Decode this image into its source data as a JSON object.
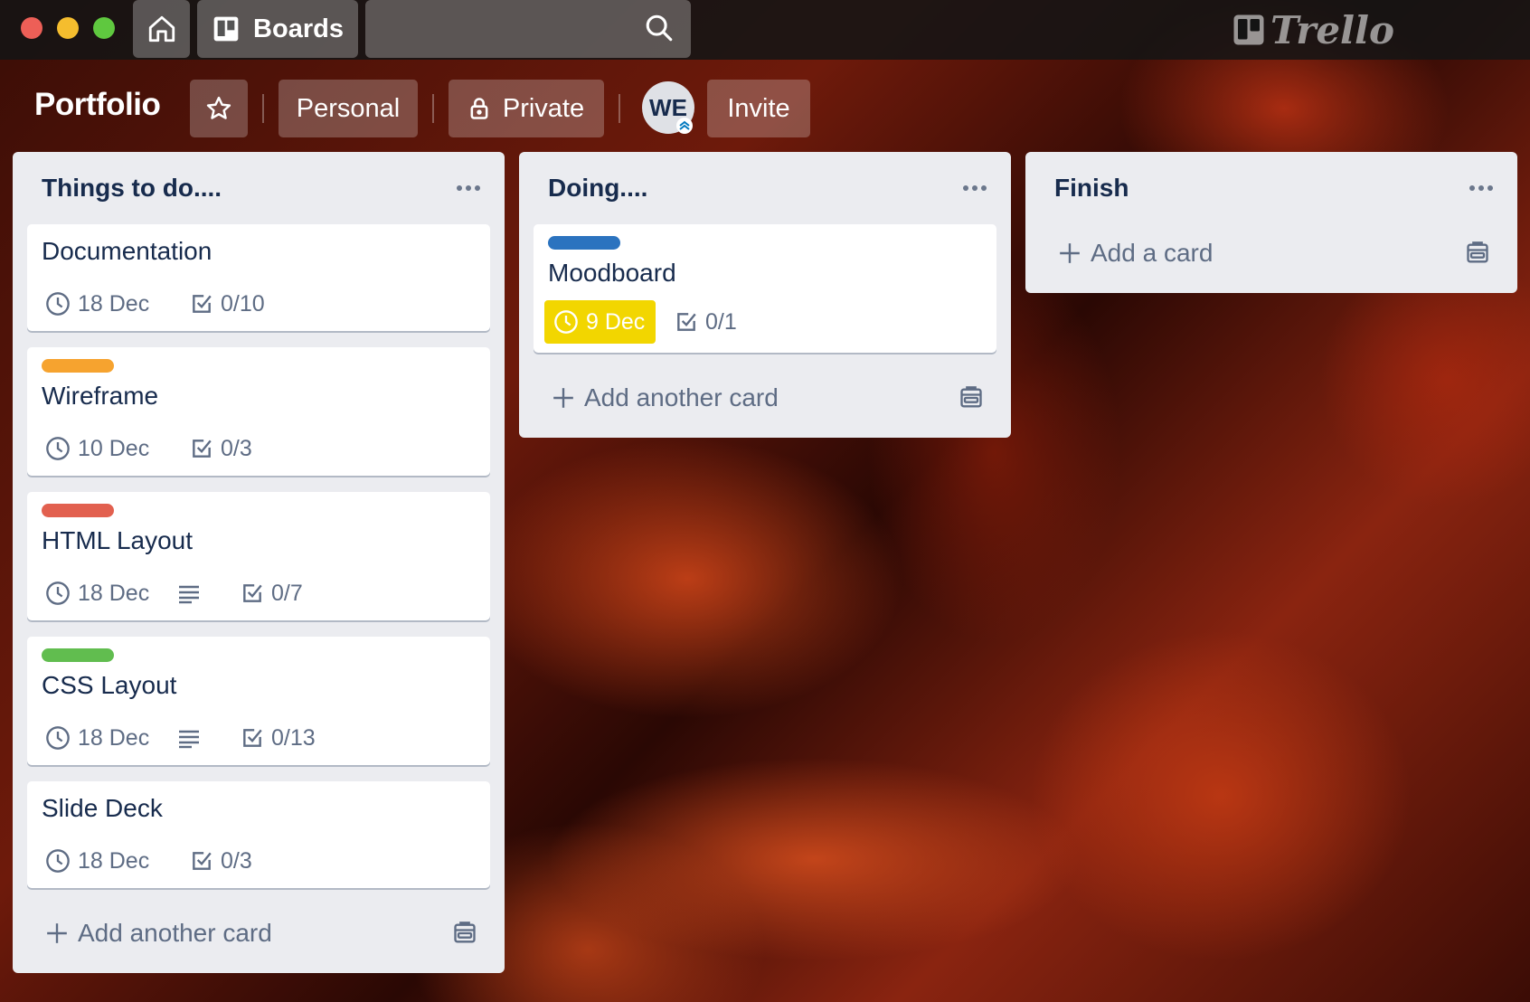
{
  "topbar": {
    "boards_label": "Boards",
    "search_placeholder": "",
    "logo_text": "Trello"
  },
  "board": {
    "title": "Portfolio",
    "visibility_team": "Personal",
    "visibility_private": "Private",
    "member_initials": "WE",
    "invite_label": "Invite"
  },
  "lists": [
    {
      "title": "Things to do....",
      "add_label": "Add another card",
      "cards": [
        {
          "title": "Documentation",
          "label_color": null,
          "due": "18 Dec",
          "checklist": "0/10",
          "has_description": false
        },
        {
          "title": "Wireframe",
          "label_color": "#f6a32f",
          "due": "10 Dec",
          "checklist": "0/3",
          "has_description": false
        },
        {
          "title": "HTML Layout",
          "label_color": "#e2604f",
          "due": "18 Dec",
          "checklist": "0/7",
          "has_description": true
        },
        {
          "title": "CSS Layout",
          "label_color": "#61bd4f",
          "due": "18 Dec",
          "checklist": "0/13",
          "has_description": true
        },
        {
          "title": "Slide Deck",
          "label_color": null,
          "due": "18 Dec",
          "checklist": "0/3",
          "has_description": false
        }
      ]
    },
    {
      "title": "Doing....",
      "add_label": "Add another card",
      "cards": [
        {
          "title": "Moodboard",
          "label_color": "#2b73bf",
          "due": "9 Dec",
          "due_soon": true,
          "checklist": "0/1",
          "has_description": false
        }
      ]
    },
    {
      "title": "Finish",
      "add_label": "Add a card",
      "cards": []
    }
  ],
  "colors": {
    "list_bg": "#ebecf0",
    "card_text": "#172b4d",
    "meta_text": "#5e6c84",
    "due_soon": "#f2d600"
  }
}
